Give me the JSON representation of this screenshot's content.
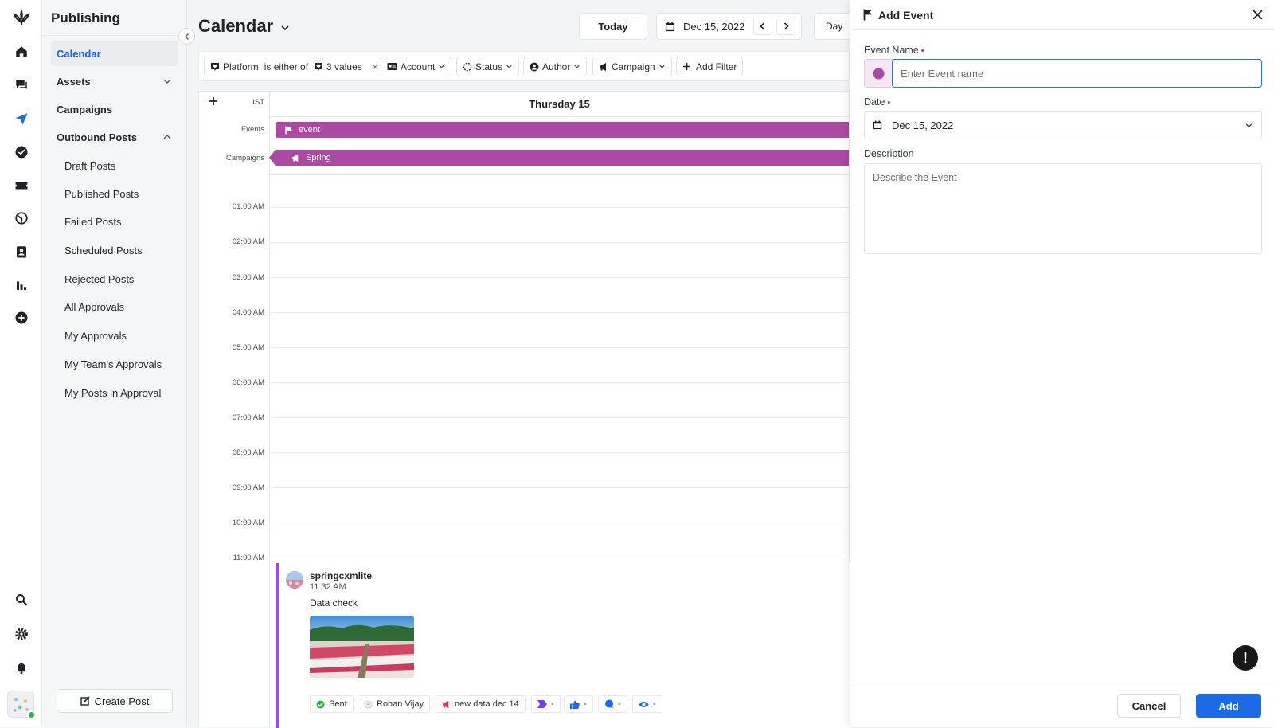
{
  "sidebar": {
    "title": "Publishing",
    "items": [
      {
        "label": "Calendar"
      },
      {
        "label": "Assets"
      },
      {
        "label": "Campaigns"
      },
      {
        "label": "Outbound Posts"
      }
    ],
    "subitems": [
      {
        "label": "Draft Posts"
      },
      {
        "label": "Published Posts"
      },
      {
        "label": "Failed Posts"
      },
      {
        "label": "Scheduled Posts"
      },
      {
        "label": "Rejected Posts"
      },
      {
        "label": "All Approvals"
      },
      {
        "label": "My Approvals"
      },
      {
        "label": "My Team's Approvals"
      },
      {
        "label": "My Posts in Approval"
      }
    ],
    "create_post": "Create Post"
  },
  "main": {
    "title": "Calendar",
    "today": "Today",
    "date": "Dec 15, 2022",
    "view": "Day",
    "filters": {
      "platform_label": "Platform",
      "platform_op": "is either of",
      "platform_value": "3 values",
      "account": "Account",
      "status": "Status",
      "author": "Author",
      "campaign": "Campaign",
      "add_filter": "Add Filter"
    },
    "calendar": {
      "timezone": "IST",
      "day_header": "Thursday 15",
      "events_label": "Events",
      "campaigns_label": "Campaigns",
      "event_name": "event",
      "campaign_name": "Spring",
      "hours": [
        "01:00 AM",
        "02:00 AM",
        "03:00 AM",
        "04:00 AM",
        "05:00 AM",
        "06:00 AM",
        "07:00 AM",
        "08:00 AM",
        "09:00 AM",
        "10:00 AM",
        "11:00 AM"
      ]
    },
    "post": {
      "account": "springcxmlite",
      "time": "11:32 AM",
      "text": "Data check",
      "status": "Sent",
      "author": "Rohan Vijay",
      "campaign": "new data dec 14",
      "dash": "-"
    }
  },
  "panel": {
    "title": "Add Event",
    "event_name_label": "Event Name",
    "event_name_placeholder": "Enter Event name",
    "date_label": "Date",
    "date_value": "Dec 15, 2022",
    "description_label": "Description",
    "description_placeholder": "Describe the Event",
    "cancel": "Cancel",
    "add": "Add",
    "alert": "!"
  },
  "colors": {
    "accent": "#1b6ae6",
    "event_purple": "#ab49a3",
    "post_border": "#9b4bea"
  }
}
